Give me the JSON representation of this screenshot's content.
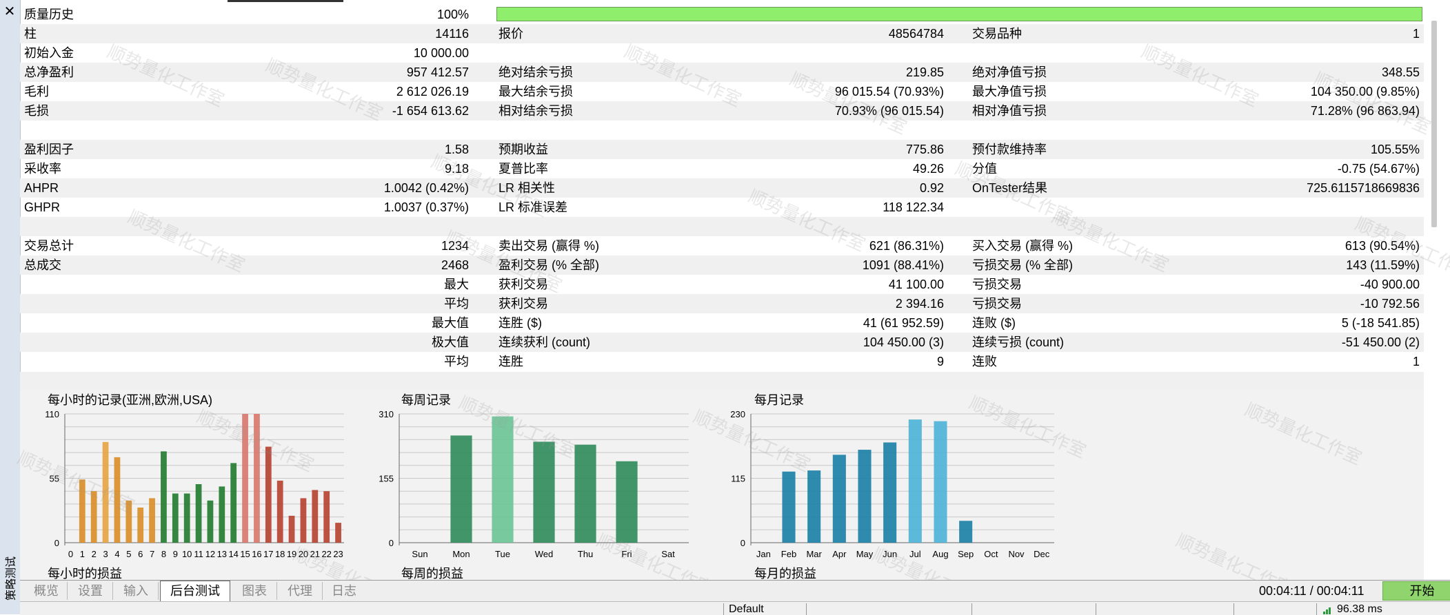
{
  "window": {
    "close_glyph": "✕",
    "panel_title": "策略测试"
  },
  "quality": {
    "label": "质量历史",
    "value": "100%",
    "fraction": 1.0
  },
  "stats": {
    "bars": {
      "k1": "柱",
      "v1": "14116",
      "k2": "报价",
      "v2": "48564784",
      "k3": "交易品种",
      "v3": "1"
    },
    "deposit": {
      "k1": "初始入金",
      "v1": "10 000.00"
    },
    "netprofit": {
      "k1": "总净盈利",
      "v1": "957 412.57",
      "k2": "绝对结余亏损",
      "v2": "219.85",
      "k3": "绝对净值亏损",
      "v3": "348.55"
    },
    "grossp": {
      "k1": "毛利",
      "v1": "2 612 026.19",
      "k2": "最大结余亏损",
      "v2": "96 015.54 (70.93%)",
      "k3": "最大净值亏损",
      "v3": "104 350.00 (9.85%)"
    },
    "grossl": {
      "k1": "毛损",
      "v1": "-1 654 613.62",
      "k2": "相对结余亏损",
      "v2": "70.93% (96 015.54)",
      "k3": "相对净值亏损",
      "v3": "71.28% (96 863.94)"
    },
    "pf": {
      "k1": "盈利因子",
      "v1": "1.58",
      "k2": "预期收益",
      "v2": "775.86",
      "k3": "预付款维持率",
      "v3": "105.55%"
    },
    "rf": {
      "k1": "采收率",
      "v1": "9.18",
      "k2": "夏普比率",
      "v2": "49.26",
      "k3": "分值",
      "v3": "-0.75 (54.67%)"
    },
    "ahpr": {
      "k1": "AHPR",
      "v1": "1.0042 (0.42%)",
      "k2": "LR 相关性",
      "v2": "0.92",
      "k3": "OnTester结果",
      "v3": "725.6115718669836"
    },
    "ghpr": {
      "k1": "GHPR",
      "v1": "1.0037 (0.37%)",
      "k2": "LR 标准误差",
      "v2": "118 122.34"
    },
    "trades": {
      "k1": "交易总计",
      "v1": "1234",
      "k2": "卖出交易 (赢得 %)",
      "v2": "621 (86.31%)",
      "k3": "买入交易 (赢得 %)",
      "v3": "613 (90.54%)"
    },
    "deals": {
      "k1": "总成交",
      "v1": "2468",
      "k2": "盈利交易 (% 全部)",
      "v2": "1091 (88.41%)",
      "k3": "亏损交易 (% 全部)",
      "v3": "143 (11.59%)"
    },
    "largest": {
      "v1": "最大",
      "k2": "获利交易",
      "v2": "41 100.00",
      "k3": "亏损交易",
      "v3": "-40 900.00"
    },
    "average": {
      "v1": "平均",
      "k2": "获利交易",
      "v2": "2 394.16",
      "k3": "亏损交易",
      "v3": "-10 792.56"
    },
    "maxcons": {
      "v1": "最大值",
      "k2": "连胜 ($)",
      "v2": "41 (61 952.59)",
      "k3": "连败 ($)",
      "v3": "5 (-18 541.85)"
    },
    "maxconsc": {
      "v1": "极大值",
      "k2": "连续获利 (count)",
      "v2": "104 450.00 (3)",
      "k3": "连续亏损 (count)",
      "v3": "-51 450.00 (2)"
    },
    "avgcons": {
      "v1": "平均",
      "k2": "连胜",
      "v2": "9",
      "k3": "连败",
      "v3": "1"
    }
  },
  "chart_data": [
    {
      "type": "bar",
      "title": "每小时的记录(亚洲,欧洲,USA)",
      "xlabel": "每小时的损益",
      "categories": [
        "0",
        "1",
        "2",
        "3",
        "4",
        "5",
        "6",
        "7",
        "8",
        "9",
        "10",
        "11",
        "12",
        "13",
        "14",
        "15",
        "16",
        "17",
        "18",
        "19",
        "20",
        "21",
        "22",
        "23"
      ],
      "values": [
        0,
        54,
        44,
        86,
        73,
        36,
        30,
        38,
        78,
        42,
        42,
        50,
        36,
        48,
        68,
        110,
        110,
        82,
        53,
        23,
        38,
        45,
        44,
        17
      ],
      "ylim": [
        0,
        110
      ],
      "yticks": [
        "0",
        "55",
        "110"
      ],
      "colors": [
        "#d98d26",
        "#d98d26",
        "#d98d26",
        "#e8a340",
        "#d98d26",
        "#d98d26",
        "#d98d26",
        "#d98d26",
        "#1f7a2e",
        "#1f7a2e",
        "#1f7a2e",
        "#1f7a2e",
        "#1f7a2e",
        "#1f7a2e",
        "#1f7a2e",
        "#d8776a",
        "#d8776a",
        "#b5402f",
        "#b5402f",
        "#b5402f",
        "#b5402f",
        "#b5402f",
        "#b5402f",
        "#b5402f"
      ]
    },
    {
      "type": "bar",
      "title": "每周记录",
      "xlabel": "每周的损益",
      "categories": [
        "Sun",
        "Mon",
        "Tue",
        "Wed",
        "Thu",
        "Fri",
        "Sat"
      ],
      "values": [
        0,
        258,
        304,
        243,
        236,
        196,
        0
      ],
      "ylim": [
        0,
        310
      ],
      "yticks": [
        "0",
        "155",
        "310"
      ],
      "colors": [
        "#2e8b5a",
        "#2e8b5a",
        "#6cc496",
        "#2e8b5a",
        "#2e8b5a",
        "#2e8b5a",
        "#2e8b5a"
      ]
    },
    {
      "type": "bar",
      "title": "每月记录",
      "xlabel": "每月的损益",
      "categories": [
        "Jan",
        "Feb",
        "Mar",
        "Apr",
        "May",
        "Jun",
        "Jul",
        "Aug",
        "Sep",
        "Oct",
        "Nov",
        "Dec"
      ],
      "values": [
        0,
        127,
        129,
        157,
        166,
        179,
        220,
        217,
        39,
        0,
        0,
        0
      ],
      "ylim": [
        0,
        230
      ],
      "yticks": [
        "0",
        "115",
        "230"
      ],
      "colors": [
        "#1a7fa5",
        "#1a7fa5",
        "#1a7fa5",
        "#1a7fa5",
        "#1a7fa5",
        "#1a7fa5",
        "#4db3d6",
        "#4db3d6",
        "#1a7fa5",
        "#1a7fa5",
        "#1a7fa5",
        "#1a7fa5"
      ]
    }
  ],
  "tabs": [
    {
      "label": "概览"
    },
    {
      "label": "设置"
    },
    {
      "label": "输入"
    },
    {
      "label": "后台测试"
    },
    {
      "label": "图表"
    },
    {
      "label": "代理"
    },
    {
      "label": "日志"
    }
  ],
  "footer": {
    "elapsed": "00:04:11 / 00:04:11",
    "start_label": "开始"
  },
  "statusbar": {
    "profile": "Default",
    "ping": "96.38 ms"
  },
  "watermark": "顺势量化工作室"
}
